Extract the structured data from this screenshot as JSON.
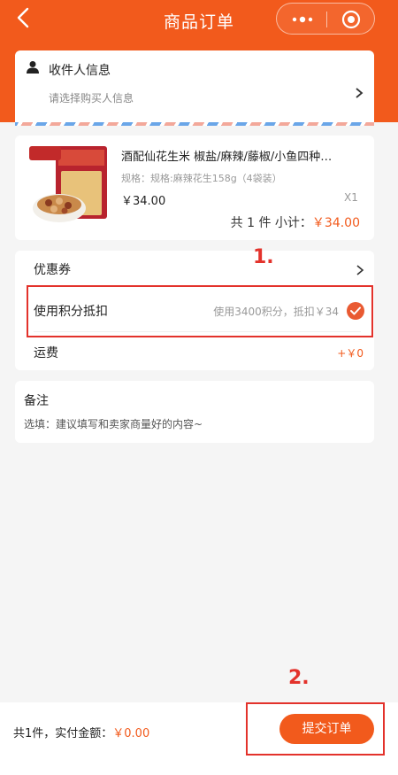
{
  "header": {
    "title": "商品订单",
    "bg_color": "#f25a1c"
  },
  "address": {
    "title": "收件人信息",
    "placeholder": "请选择购买人信息"
  },
  "product": {
    "name": "酒配仙花生米 椒盐/麻辣/藤椒/小鱼四种…",
    "spec": "规格：规格:麻辣花生158g（4袋装）",
    "price": "￥34.00",
    "quantity": "X1",
    "total_label": "共 1 件   小计：",
    "total_amount": "￥34.00"
  },
  "options": {
    "coupon_label": "优惠券",
    "points_label": "使用积分抵扣",
    "points_value": "使用3400积分，抵扣￥34",
    "shipping_label": "运费",
    "shipping_value": "+￥0"
  },
  "note": {
    "title": "备注",
    "hint": "选填：建议填写和卖家商量好的内容~"
  },
  "footer": {
    "summary_label": "共1件，实付金额：",
    "summary_amount": "￥0.00",
    "submit_label": "提交订单"
  },
  "annotations": {
    "marker_1": "1.",
    "marker_2": "2."
  },
  "colors": {
    "accent": "#f25a1c",
    "annotation": "#e3322b"
  }
}
